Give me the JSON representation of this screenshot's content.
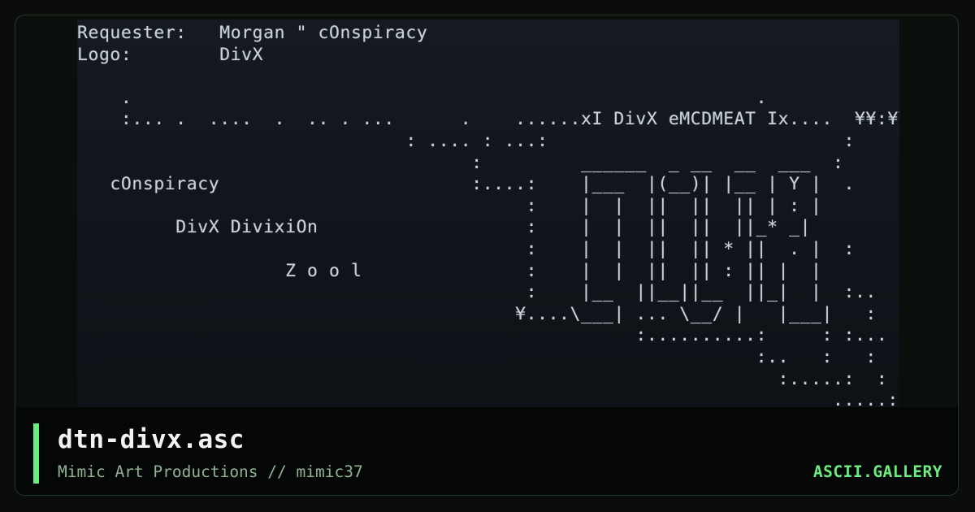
{
  "artwork": {
    "lines": [
      "Requester:   Morgan \" cOnspiracy",
      "Logo:        DivX",
      "",
      "    .                                                         .",
      "    :... .  ....  .  .. . ...      .    ......xI DivX eMCDMEAT Ix....  ¥¥:¥¥ ¥¥¥",
      "                              : .... : ...:                           :",
      "                                    :         ______  _ __  __  ___  :",
      "   cOnspiracy                       :....:    |___  |(__)| |__ | Y |  .",
      "                                         :    |  |  ||  ||  || | : |",
      "         DivX DivixiOn                   :    |  |  ||  ||  ||_* _|",
      "                                         :    |  |  ||  || * ||  . |  :",
      "                   Z o o l               :    |  |  ||  || : || |  |",
      "                                         :    |__  ||__||__  ||_|  |  :..",
      "                                        ¥....\\___| ... \\__/ |   |___|   :",
      "                                                   :..........:     : :...",
      "                                                              :..   :   :",
      "                                                                :.....:  :",
      "                                                                     .....:"
    ]
  },
  "caption": {
    "title": "dtn-divx.asc",
    "subtitle": "Mimic Art Productions // mimic37",
    "brand": "ASCII.GALLERY"
  },
  "colors": {
    "accent": "#6bec7e",
    "background": "#0b0f0c",
    "art_background": "#11151b"
  }
}
